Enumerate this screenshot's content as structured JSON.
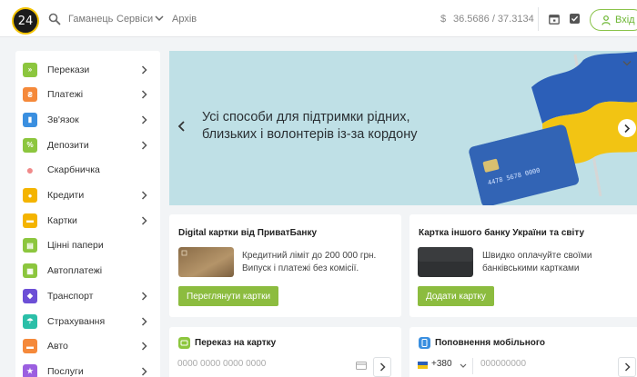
{
  "header": {
    "logo_text": "24",
    "links": [
      "Гаманець",
      "Сервіси",
      "Архів"
    ],
    "currency_sign": "$",
    "rate": "36.5686 / 37.3134",
    "login_label": "Вхід"
  },
  "sidebar": {
    "items": [
      {
        "label": "Перекази",
        "icon": "arrows-icon",
        "color": "#8cc63e",
        "chevron": true
      },
      {
        "label": "Платежі",
        "icon": "money-icon",
        "color": "#f5893a",
        "chevron": true
      },
      {
        "label": "Зв'язок",
        "icon": "signal-icon",
        "color": "#3a8fe0",
        "chevron": true
      },
      {
        "label": "Депозити",
        "icon": "percent-icon",
        "color": "#8cc63e",
        "chevron": true
      },
      {
        "label": "Скарбничка",
        "icon": "piggy-bank-icon",
        "color": "#f08a8a",
        "chevron": false
      },
      {
        "label": "Кредити",
        "icon": "coin-bag-icon",
        "color": "#f4b400",
        "chevron": true
      },
      {
        "label": "Картки",
        "icon": "card-icon",
        "color": "#f4b400",
        "chevron": true
      },
      {
        "label": "Цінні папери",
        "icon": "document-icon",
        "color": "#8cc63e",
        "chevron": false
      },
      {
        "label": "Автоплатежі",
        "icon": "calendar-icon",
        "color": "#8cc63e",
        "chevron": false
      },
      {
        "label": "Транспорт",
        "icon": "transport-icon",
        "color": "#6c4fd6",
        "chevron": true
      },
      {
        "label": "Страхування",
        "icon": "umbrella-icon",
        "color": "#2bbfa8",
        "chevron": true
      },
      {
        "label": "Авто",
        "icon": "car-icon",
        "color": "#f5893a",
        "chevron": true
      },
      {
        "label": "Послуги",
        "icon": "star-icon",
        "color": "#9b5fe0",
        "chevron": true
      }
    ]
  },
  "banner": {
    "text": "Усі способи для підтримки рідних, близьких і волонтерів із-за кордону"
  },
  "cards": {
    "digital": {
      "title": "Digital картки від ПриватБанку",
      "desc": "Кредитний ліміт до 200 000 грн. Випуск і платежі без комісії.",
      "button": "Переглянути картки"
    },
    "other": {
      "title": "Картка іншого банку України та світу",
      "desc": "Швидко оплачуйте своїми банківськими картками",
      "button": "Додати картку"
    }
  },
  "transfer": {
    "title": "Переказ на картку",
    "placeholder": "0000 0000 0000 0000"
  },
  "mobile": {
    "title": "Поповнення мобільного",
    "code": "+380",
    "placeholder": "000000000"
  },
  "colors": {
    "accent_green": "#8cbc3f",
    "banner_bg": "#bfe0e6",
    "page_bg": "#f2f4f6"
  }
}
